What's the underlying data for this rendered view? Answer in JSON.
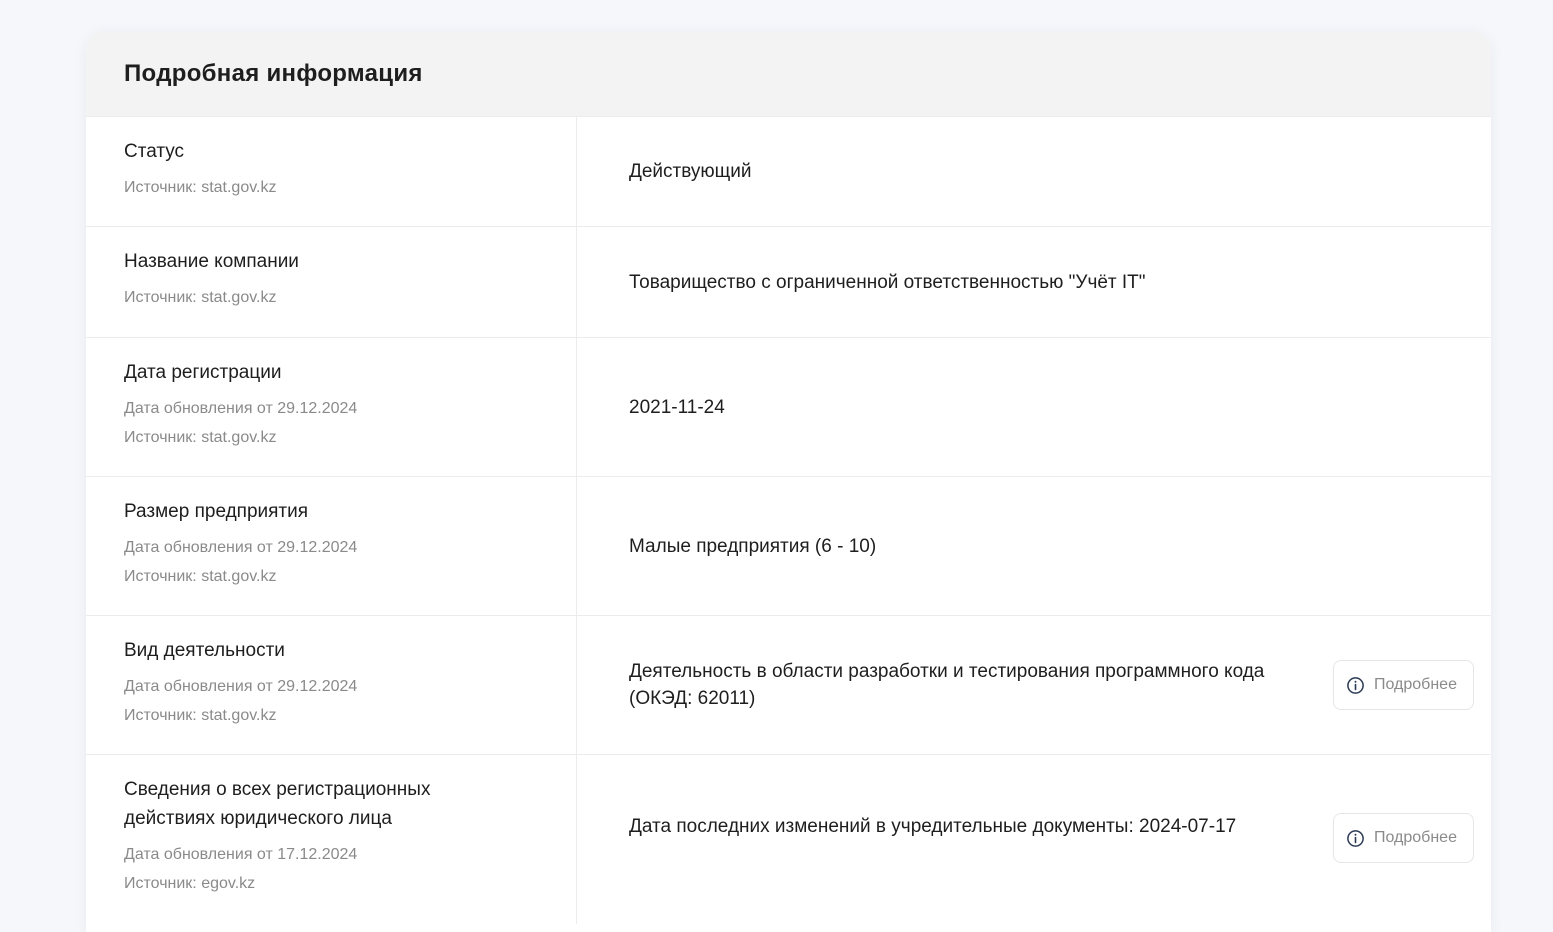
{
  "panel": {
    "title": "Подробная информация"
  },
  "rows": [
    {
      "label": "Статус",
      "source": "Источник: stat.gov.kz",
      "value": "Действующий"
    },
    {
      "label": "Название компании",
      "source": "Источник: stat.gov.kz",
      "value": "Товарищество с ограниченной ответственностью \"Учёт IT\""
    },
    {
      "label": "Дата регистрации",
      "updated": "Дата обновления от 29.12.2024",
      "source": "Источник: stat.gov.kz",
      "value": "2021-11-24"
    },
    {
      "label": "Размер предприятия",
      "updated": "Дата обновления от 29.12.2024",
      "source": "Источник: stat.gov.kz",
      "value": "Малые предприятия (6 - 10)"
    },
    {
      "label": "Вид деятельности",
      "updated": "Дата обновления от 29.12.2024",
      "source": "Источник: stat.gov.kz",
      "value": "Деятельность в области разработки и тестирования программного кода (ОКЭД: 62011)",
      "button_label": "Подробнее",
      "button_icon": "info-icon"
    },
    {
      "label": "Сведения о всех регистрационных действиях юридического лица",
      "updated": "Дата обновления от 17.12.2024",
      "source": "Источник: egov.kz",
      "value": "Дата последних изменений в учредительные документы: 2024-07-17",
      "button_label": "Подробнее",
      "button_icon": "info-icon"
    }
  ]
}
